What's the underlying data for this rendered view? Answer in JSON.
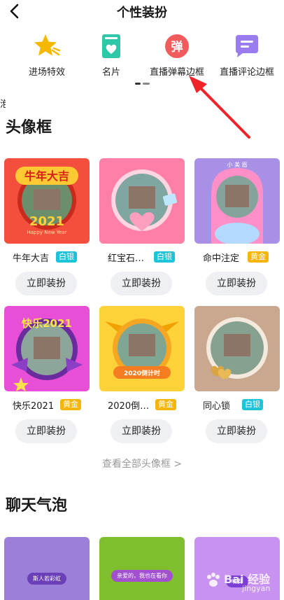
{
  "header": {
    "title": "个性装扮",
    "back_icon": "chevron-left-icon"
  },
  "categories": {
    "cut_label": "泡",
    "items": [
      {
        "label": "进场特效",
        "icon": "star-icon",
        "color": "#f5b800"
      },
      {
        "label": "名片",
        "icon": "card-icon",
        "color": "#2ec7a8"
      },
      {
        "label": "直播弹幕边框",
        "icon": "danmu-icon",
        "glyph": "弹",
        "color": "#f25b5b"
      },
      {
        "label": "直播评论边框",
        "icon": "comment-icon",
        "color": "#9b7cf0"
      }
    ]
  },
  "avatar_frames": {
    "title": "头像框",
    "action_label": "立即装扮",
    "items": [
      {
        "name": "牛年大吉",
        "badge": "白银",
        "tier": "silver",
        "overlay": "牛年大吉",
        "sub": "2021",
        "sub2": "Happy New Year"
      },
      {
        "name": "红宝石…",
        "badge": "白银",
        "tier": "silver"
      },
      {
        "name": "命中注定",
        "badge": "黄金",
        "tier": "gold",
        "overlay": "小 美 眉"
      },
      {
        "name": "快乐2021",
        "badge": "黄金",
        "tier": "gold",
        "overlay": "快乐2021"
      },
      {
        "name": "2020倒…",
        "badge": "黄金",
        "tier": "gold",
        "overlay": "2020倒计时"
      },
      {
        "name": "同心锁",
        "badge": "白银",
        "tier": "silver"
      }
    ],
    "view_all": "查看全部头像框 >"
  },
  "chat_bubbles": {
    "title": "聊天气泡",
    "items": [
      {
        "text": "斯人若彩虹",
        "color": "#9c7fd8"
      },
      {
        "text": "亲爱的，我也在看你",
        "color": "#7fbf2e"
      },
      {
        "text": "晚安",
        "color": "#c792f0"
      }
    ]
  },
  "watermark": {
    "text": "Bai 经验",
    "sub": "jingyan"
  }
}
